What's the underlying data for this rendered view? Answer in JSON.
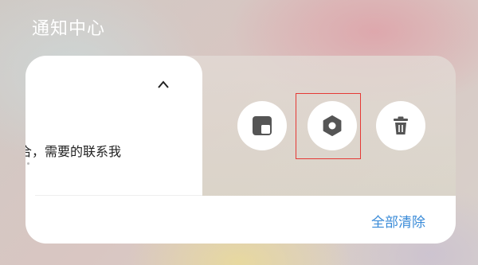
{
  "header": {
    "title": "通知中心"
  },
  "notification": {
    "body_text": "合，需要的联系我"
  },
  "actions": {
    "fold": {
      "icon": "folded-square-icon"
    },
    "settings": {
      "icon": "hexagon-gear-icon"
    },
    "delete": {
      "icon": "trash-icon"
    }
  },
  "footer": {
    "clear_all_label": "全部清除"
  },
  "colors": {
    "accent": "#3a8bd8",
    "highlight": "#e53935",
    "icon": "#555555"
  }
}
